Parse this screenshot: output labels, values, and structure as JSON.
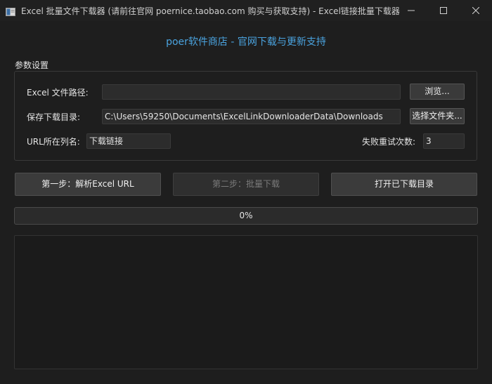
{
  "window": {
    "title": "Excel 批量文件下载器 (请前往官网 poernice.taobao.com 购买与获取支持) - Excel链接批量下载器"
  },
  "header": {
    "store_link": "poer软件商店 - 官网下载与更新支持",
    "link_color": "#4aa3df"
  },
  "settings": {
    "group_title": "参数设置",
    "excel_path": {
      "label": "Excel 文件路径:",
      "value": "",
      "browse_label": "浏览..."
    },
    "save_dir": {
      "label": "保存下载目录:",
      "value": "C:\\Users\\59250\\Documents\\ExcelLinkDownloaderData\\Downloads",
      "choose_label": "选择文件夹..."
    },
    "url_column": {
      "label": "URL所在列名:",
      "value": "下载链接"
    },
    "retry": {
      "label": "失败重试次数:",
      "value": "3"
    }
  },
  "actions": {
    "step1_label": "第一步：解析Excel URL",
    "step2_label": "第二步：批量下载",
    "step2_enabled": false,
    "open_dir_label": "打开已下载目录"
  },
  "progress": {
    "value": 0,
    "text": "0%"
  },
  "log": {
    "content": ""
  },
  "icons": {
    "app": "app-window-icon",
    "minimize": "minimize-icon",
    "maximize": "maximize-icon",
    "close": "close-icon"
  }
}
